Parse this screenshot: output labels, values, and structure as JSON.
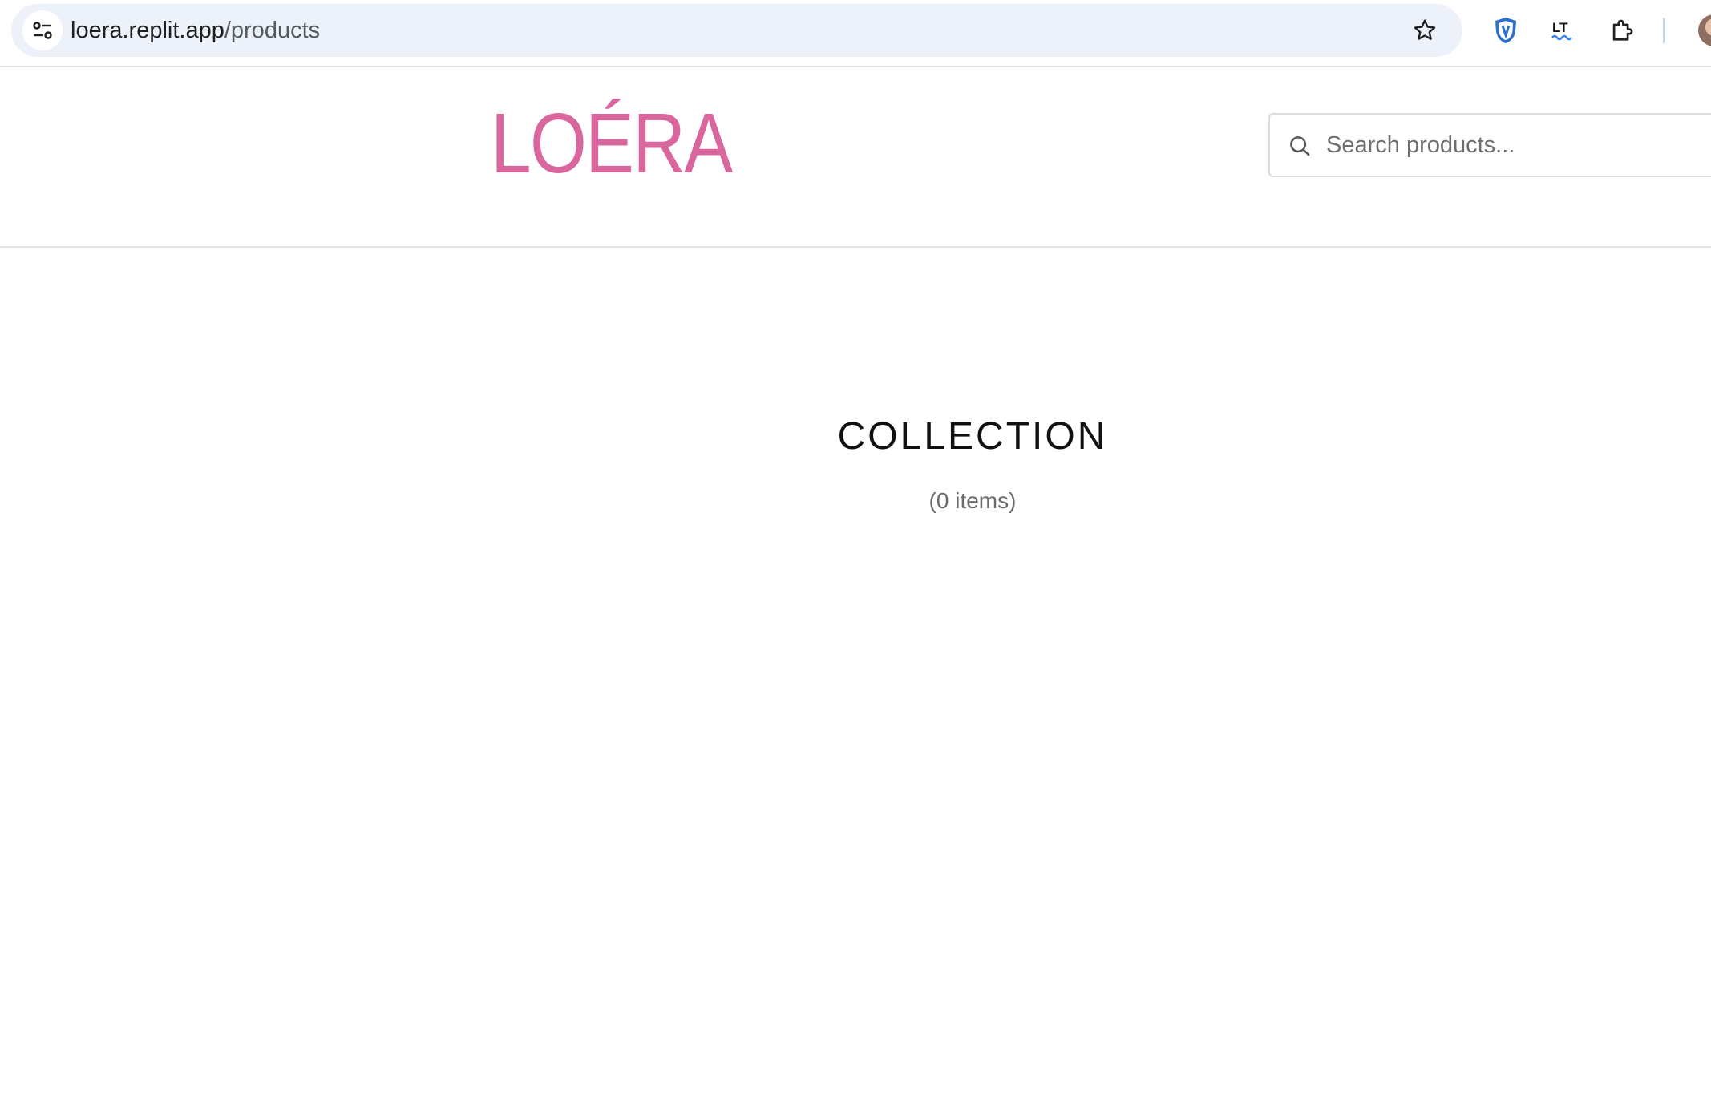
{
  "browser": {
    "url_host": "loera.replit.app",
    "url_path": "/products",
    "icons": {
      "site_info": "tune-icon",
      "bookmark": "star-icon",
      "extension_1": "shield-icon",
      "extension_2": "languagetool-icon",
      "extensions_menu": "puzzle-icon",
      "profile": "avatar"
    }
  },
  "header": {
    "logo_text": "LOÉRA",
    "logo_color": "#d9679e",
    "search": {
      "placeholder": "Search products...",
      "value": ""
    }
  },
  "main": {
    "title": "COLLECTION",
    "item_count": "(0 items)"
  }
}
